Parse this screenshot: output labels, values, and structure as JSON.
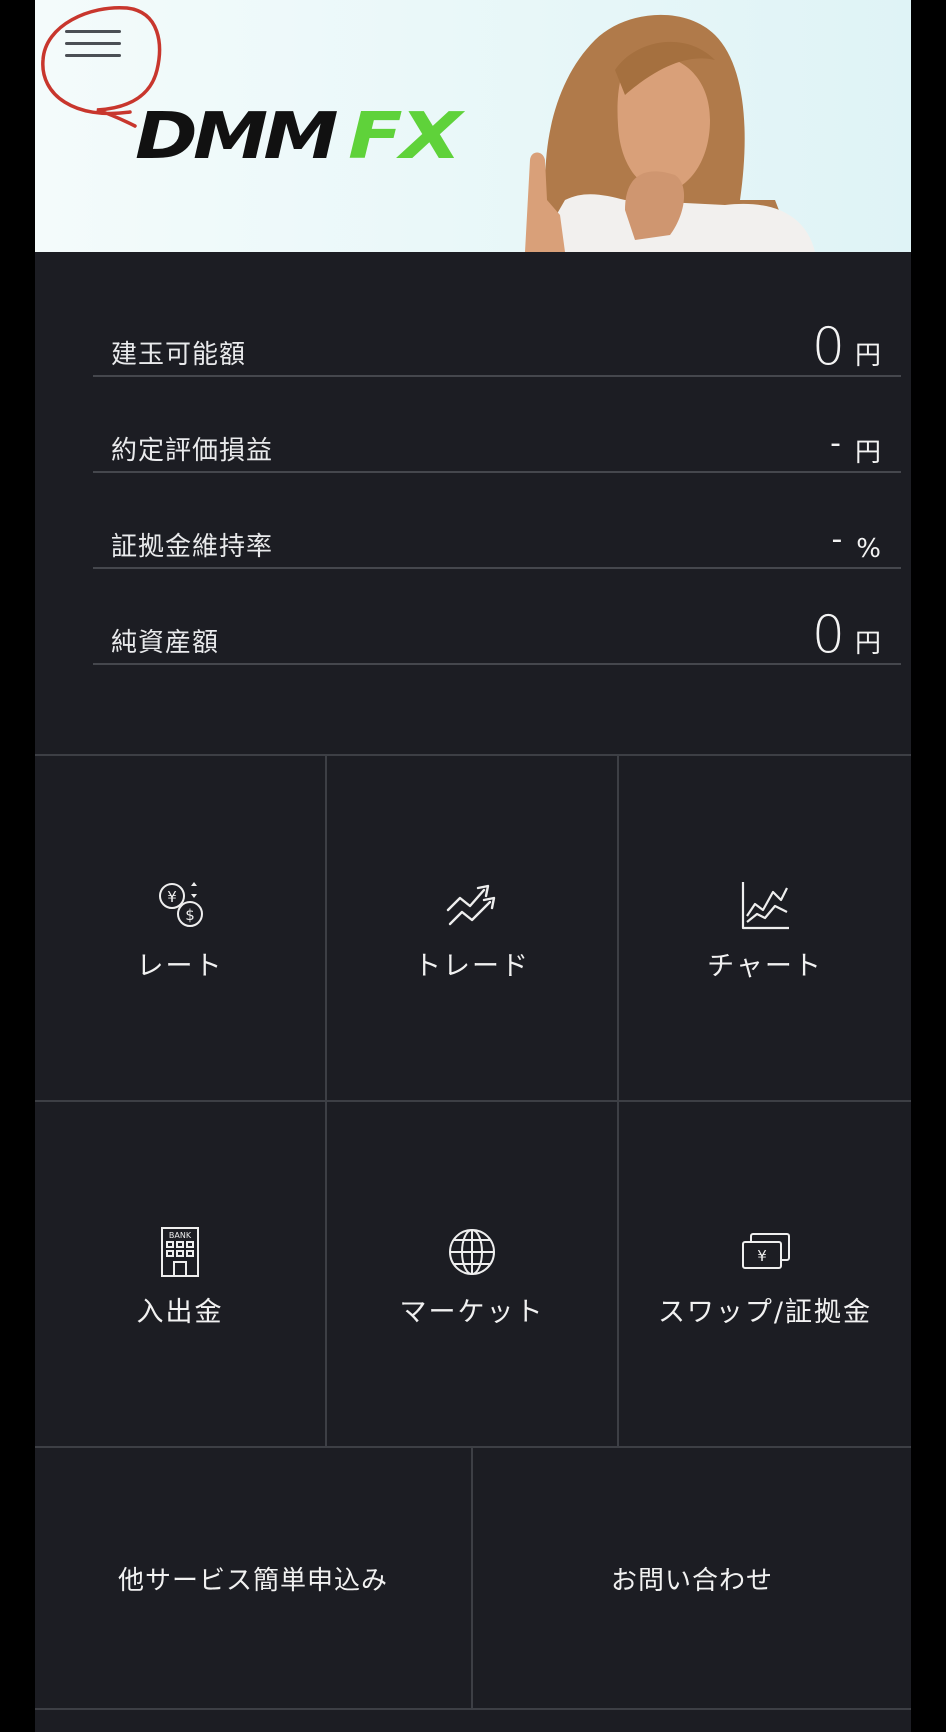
{
  "banner": {
    "logo_part1": "DMM",
    "logo_part2": "FX"
  },
  "summary": [
    {
      "label": "建玉可能額",
      "value": "0",
      "unit": "円"
    },
    {
      "label": "約定評価損益",
      "value": "-",
      "unit": "円"
    },
    {
      "label": "証拠金維持率",
      "value": "-",
      "unit": "%"
    },
    {
      "label": "純資産額",
      "value": "0",
      "unit": "円"
    }
  ],
  "menu": [
    {
      "label": "レート",
      "icon": "currency-exchange-icon"
    },
    {
      "label": "トレード",
      "icon": "trend-arrows-icon"
    },
    {
      "label": "チャート",
      "icon": "chart-icon"
    },
    {
      "label": "入出金",
      "icon": "bank-icon"
    },
    {
      "label": "マーケット",
      "icon": "globe-icon"
    },
    {
      "label": "スワップ/証拠金",
      "icon": "yen-cards-icon"
    }
  ],
  "links": [
    {
      "label": "他サービス簡単申込み"
    },
    {
      "label": "お問い合わせ"
    }
  ],
  "colors": {
    "background": "#1c1d23",
    "divider": "#3d3f45",
    "logo_green": "#5fd23a",
    "annotation_red": "#c8362d"
  }
}
